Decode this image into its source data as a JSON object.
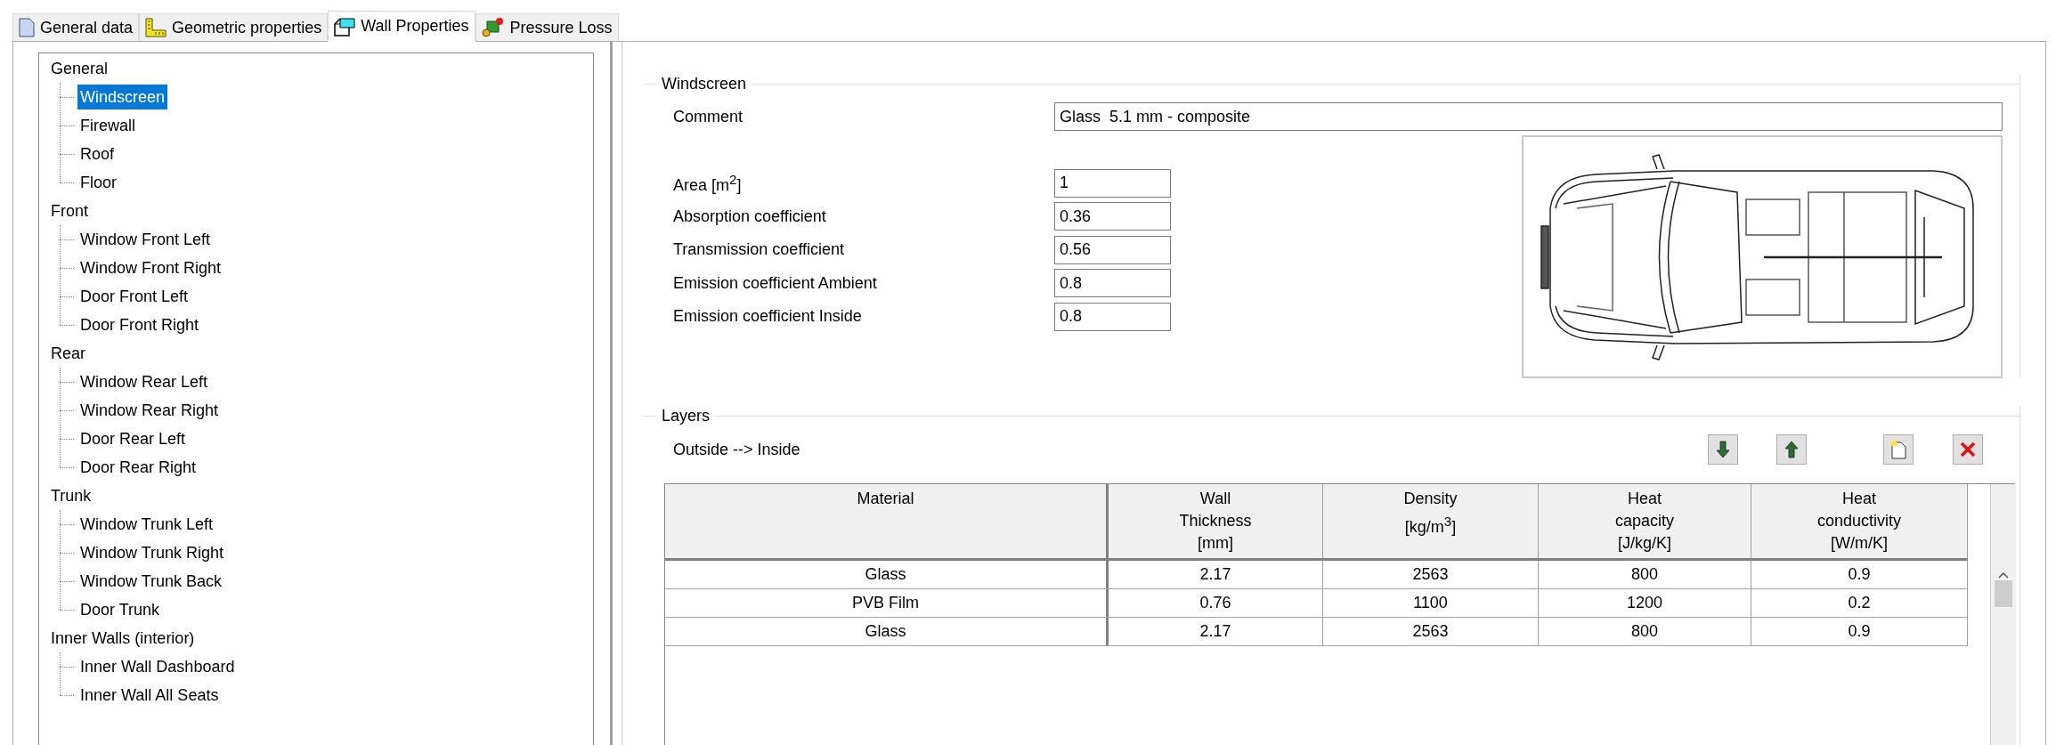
{
  "tabs": [
    {
      "label": "General data",
      "kind": "document",
      "selected": false
    },
    {
      "label": "Geometric properties",
      "kind": "ruler",
      "selected": false
    },
    {
      "label": "Wall Properties",
      "kind": "wall",
      "selected": true
    },
    {
      "label": "Pressure Loss",
      "kind": "pressure",
      "selected": false
    }
  ],
  "tree": [
    {
      "label": "General",
      "selected": false,
      "children": [
        {
          "label": "Windscreen",
          "selected": true
        },
        {
          "label": "Firewall",
          "selected": false
        },
        {
          "label": "Roof",
          "selected": false
        },
        {
          "label": "Floor",
          "selected": false
        }
      ]
    },
    {
      "label": "Front",
      "selected": false,
      "children": [
        {
          "label": "Window Front Left",
          "selected": false
        },
        {
          "label": "Window Front Right",
          "selected": false
        },
        {
          "label": "Door Front Left",
          "selected": false
        },
        {
          "label": "Door Front Right",
          "selected": false
        }
      ]
    },
    {
      "label": "Rear",
      "selected": false,
      "children": [
        {
          "label": "Window Rear Left",
          "selected": false
        },
        {
          "label": "Window Rear Right",
          "selected": false
        },
        {
          "label": "Door Rear Left",
          "selected": false
        },
        {
          "label": "Door Rear Right",
          "selected": false
        }
      ]
    },
    {
      "label": "Trunk",
      "selected": false,
      "children": [
        {
          "label": "Window Trunk Left",
          "selected": false
        },
        {
          "label": "Window Trunk Right",
          "selected": false
        },
        {
          "label": "Window Trunk Back",
          "selected": false
        },
        {
          "label": "Door Trunk",
          "selected": false
        }
      ]
    },
    {
      "label": "Inner Walls (interior)",
      "selected": false,
      "children": [
        {
          "label": "Inner Wall Dashboard",
          "selected": false
        },
        {
          "label": "Inner Wall All Seats",
          "selected": false
        }
      ]
    }
  ],
  "windscreen": {
    "title": "Windscreen",
    "comment": {
      "label": "Comment",
      "value": "Glass  5.1 mm - composite"
    },
    "properties": [
      {
        "label": "Area [m$^{2}$]",
        "value": "1"
      },
      {
        "label": "Absorption coefficient",
        "value": "0.36"
      },
      {
        "label": "Transmission coefficient",
        "value": "0.56"
      },
      {
        "label": "Emission coefficient Ambient",
        "value": "0.8"
      },
      {
        "label": "Emission coefficient Inside",
        "value": "0.8"
      }
    ]
  },
  "layers": {
    "title": "Layers",
    "direction": "Outside --> Inside",
    "buttons": [
      {
        "kind": "move-down"
      },
      {
        "kind": "move-up"
      },
      {
        "kind": "new"
      },
      {
        "kind": "delete"
      }
    ],
    "columns": [
      "Material",
      "Wall\nThickness\n[mm]",
      "Density\n[kg/m$^{3}$]",
      "Heat\ncapacity\n[J/kg/K]",
      "Heat\nconductivity\n[W/m/K]"
    ],
    "rows": [
      [
        "Glass",
        "2.17",
        "2563",
        "800",
        "0.9"
      ],
      [
        "PVB Film",
        "0.76",
        "1100",
        "1200",
        "0.2"
      ],
      [
        "Glass",
        "2.17",
        "2563",
        "800",
        "0.9"
      ]
    ]
  }
}
